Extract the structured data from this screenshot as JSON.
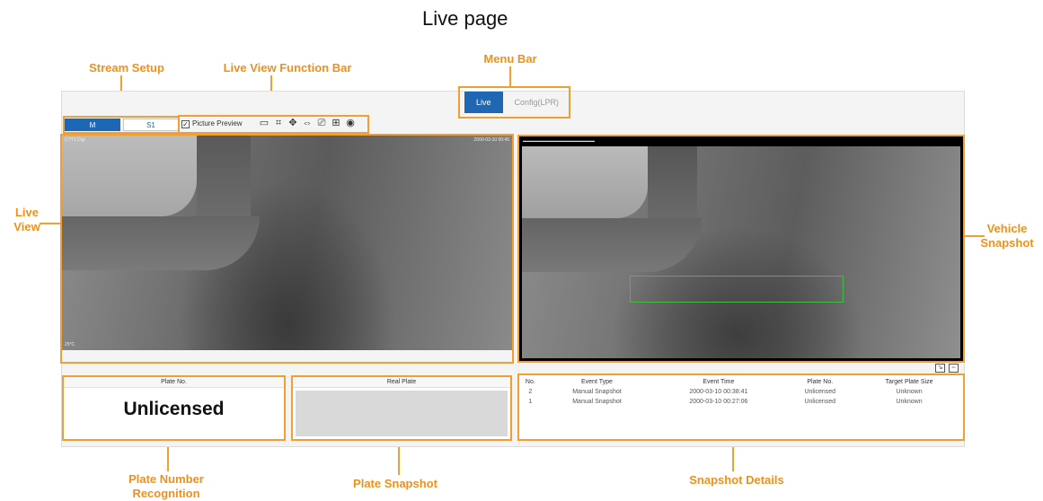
{
  "page_title": "Live page",
  "callouts": {
    "stream_setup": "Stream Setup",
    "live_view_function_bar": "Live View Function Bar",
    "menu_bar": "Menu Bar",
    "live_view": "Live View",
    "vehicle_snapshot": "Vehicle Snapshot",
    "plate_number_recognition": "Plate Number Recognition",
    "plate_snapshot": "Plate Snapshot",
    "snapshot_details": "Snapshot Details"
  },
  "menu": {
    "tabs": [
      {
        "label": "Live",
        "active": true
      },
      {
        "label": "Config(LPR)",
        "active": false
      }
    ]
  },
  "stream": {
    "main_label": "M",
    "sub_label": "S1"
  },
  "function_bar": {
    "picture_preview_label": "Picture Preview",
    "picture_preview_checked": true,
    "icons": [
      "ratio-icon",
      "crop-icon",
      "move-icon",
      "fit-width-icon",
      "record-icon",
      "zoom-icon",
      "snapshot-icon"
    ]
  },
  "live_view": {
    "osd_top_left": "CTY1  Digi",
    "osd_top_right": "2000-03-10  00:45",
    "osd_bottom_left": "25°C"
  },
  "plate_panel": {
    "header": "Plate No.",
    "value": "Unlicensed"
  },
  "real_plate_panel": {
    "header": "Real Plate"
  },
  "snapshot_table": {
    "columns": [
      "No.",
      "Event Type",
      "Event Time",
      "Plate No.",
      "Target Plate Size"
    ],
    "rows": [
      [
        "2",
        "Manual Snapshot",
        "2000-03-10 00:38:41",
        "Unlicensed",
        "Unknown"
      ],
      [
        "1",
        "Manual Snapshot",
        "2000-03-10 00:27:06",
        "Unlicensed",
        "Unknown"
      ]
    ]
  },
  "colors": {
    "accent": "#1e67b3",
    "callout": "#f0901a",
    "detection": "#3fbf3f"
  }
}
